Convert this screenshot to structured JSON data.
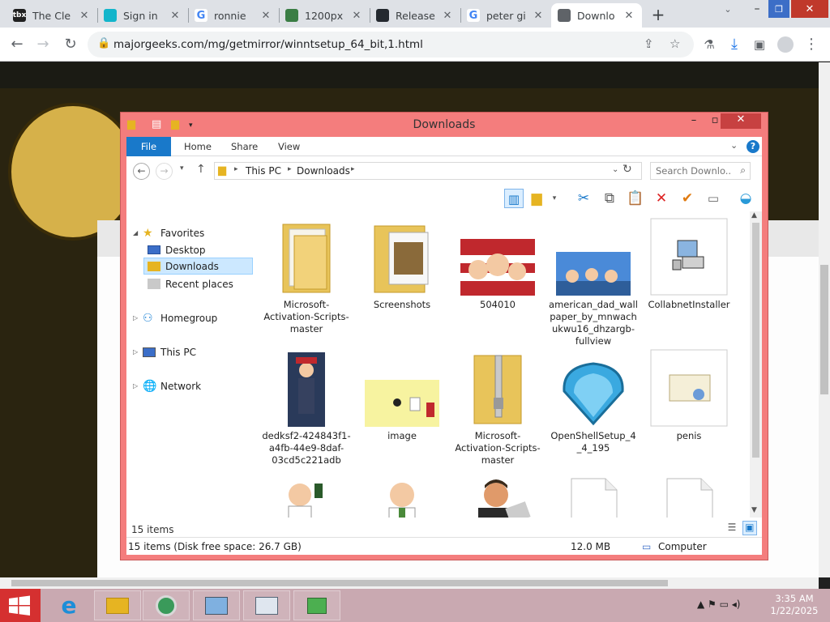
{
  "browser": {
    "tabs": [
      {
        "title": "The Cle",
        "fav_color": "#202020",
        "fav_text": "tbx",
        "active": false
      },
      {
        "title": "Sign in",
        "fav_color": "#12b5cb",
        "fav_text": "",
        "active": false
      },
      {
        "title": "ronnie",
        "fav_color": "#ffffff",
        "fav_text": "G",
        "active": false
      },
      {
        "title": "1200px",
        "fav_color": "#3a7d44",
        "fav_text": "",
        "active": false
      },
      {
        "title": "Release",
        "fav_color": "#24292f",
        "fav_text": "",
        "active": false
      },
      {
        "title": "peter gi",
        "fav_color": "#ffffff",
        "fav_text": "G",
        "active": false
      },
      {
        "title": "Downlo",
        "fav_color": "#5f6368",
        "fav_text": "",
        "active": true
      }
    ],
    "url": "majorgeeks.com/mg/getmirror/winntsetup_64_bit,1.html"
  },
  "explorer": {
    "title": "Downloads",
    "ribbon_tabs": [
      "File",
      "Home",
      "Share",
      "View"
    ],
    "breadcrumb": [
      "This PC",
      "Downloads"
    ],
    "search_placeholder": "Search Downlo...",
    "nav": {
      "favorites": "Favorites",
      "desktop": "Desktop",
      "downloads": "Downloads",
      "recent": "Recent places",
      "homegroup": "Homegroup",
      "thispc": "This PC",
      "network": "Network"
    },
    "files": [
      {
        "name": "Microsoft-Activation-Scripts-master",
        "kind": "folder-docs"
      },
      {
        "name": "Screenshots",
        "kind": "folder-pics"
      },
      {
        "name": "504010",
        "kind": "image-family"
      },
      {
        "name": "american_dad_wallpaper_by_mnwachukwu16_dhzargb-fullview",
        "kind": "image-wallpaper"
      },
      {
        "name": "CollabnetInstaller",
        "kind": "installer"
      },
      {
        "name": "dedksf2-424843f1-a4fb-44e9-8daf-03cd5c221adb",
        "kind": "image-tall"
      },
      {
        "name": "image",
        "kind": "image-yellow"
      },
      {
        "name": "Microsoft-Activation-Scripts-master",
        "kind": "zip"
      },
      {
        "name": "OpenShellSetup_4_4_195",
        "kind": "shell"
      },
      {
        "name": "penis",
        "kind": "certificate"
      },
      {
        "name": "",
        "kind": "peter1"
      },
      {
        "name": "",
        "kind": "peter2"
      },
      {
        "name": "",
        "kind": "man"
      },
      {
        "name": "",
        "kind": "blank"
      },
      {
        "name": "",
        "kind": "blank"
      }
    ],
    "item_count": "15 items",
    "status_left": "15 items (Disk free space: 26.7 GB)",
    "status_size": "12.0 MB",
    "status_location": "Computer"
  },
  "taskbar": {
    "time": "3:35 AM",
    "date": "1/22/2025"
  }
}
